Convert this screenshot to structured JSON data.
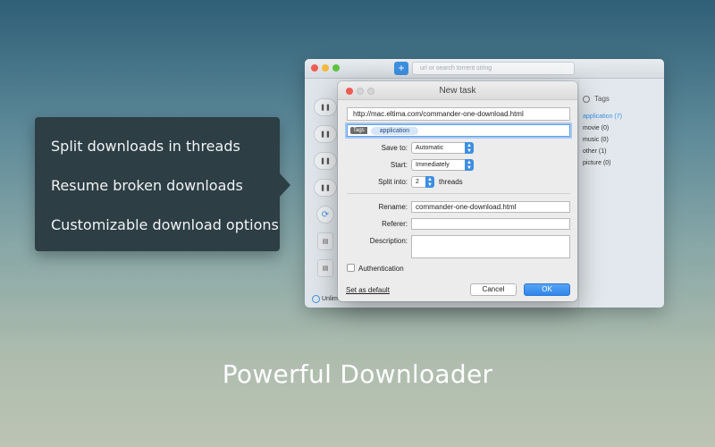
{
  "background_app": {
    "url_placeholder": "url or search torrent string",
    "add_button_label": "+",
    "list_icons": [
      "pause",
      "pause",
      "pause",
      "pause",
      "sync",
      "file",
      "file"
    ],
    "tags_header": "Tags",
    "tags": [
      {
        "label": "application (7)",
        "active": true
      },
      {
        "label": "movie (0)",
        "active": false
      },
      {
        "label": "music (0)",
        "active": false
      },
      {
        "label": "other (1)",
        "active": false
      },
      {
        "label": "picture (0)",
        "active": false
      }
    ],
    "footer_speed": "Unlim"
  },
  "dialog": {
    "title": "New task",
    "url": "http://mac.eltima.com/commander-one-download.html",
    "tags_label": "Tags",
    "tag_chip": "application",
    "save_to_label": "Save to:",
    "save_to_value": "Automatic",
    "start_label": "Start:",
    "start_value": "Immediately",
    "split_label": "Split into:",
    "split_value": "2",
    "split_suffix": "threads",
    "rename_label": "Rename:",
    "rename_value": "commander-one-download.html",
    "referer_label": "Referer:",
    "referer_value": "",
    "description_label": "Description:",
    "description_value": "",
    "authentication_label": "Authentication",
    "authentication_checked": false,
    "set_default_label": "Set as default",
    "cancel_label": "Cancel",
    "ok_label": "OK"
  },
  "callout": {
    "lines": [
      "Split downloads in threads",
      "Resume broken downloads",
      "Customizable download options"
    ]
  },
  "headline": "Powerful Downloader",
  "colors": {
    "accent": "#3d8fe0",
    "callout_bg": "#2d3e45"
  }
}
